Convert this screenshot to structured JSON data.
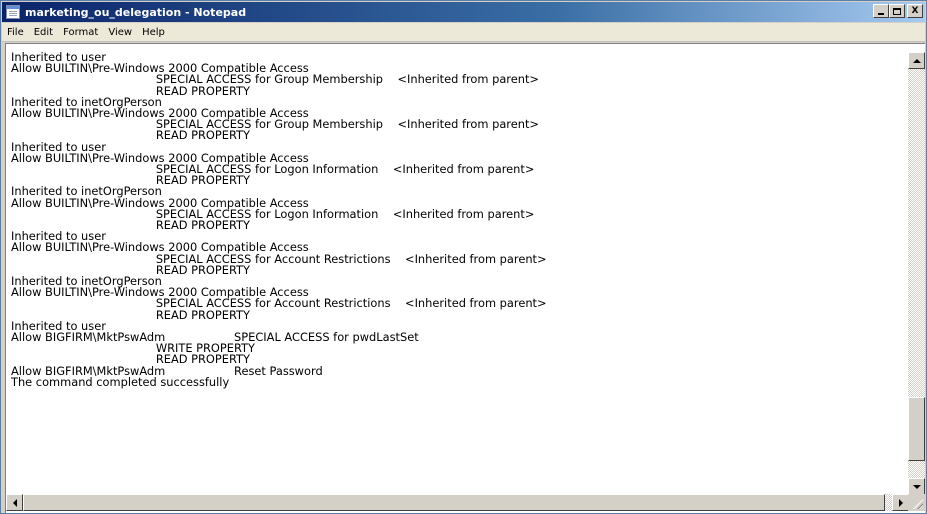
{
  "window": {
    "title": "marketing_ou_delegation - Notepad",
    "app_icon": "notepad-icon"
  },
  "title_buttons": {
    "minimize": "minimize-icon",
    "maximize": "maximize-icon",
    "close_label": "X"
  },
  "menu": [
    {
      "label": "File"
    },
    {
      "label": "Edit"
    },
    {
      "label": "Format"
    },
    {
      "label": "View"
    },
    {
      "label": "Help"
    }
  ],
  "document": {
    "text": "Inherited to user\nAllow BUILTIN\\Pre-Windows 2000 Compatible Access\n                                        SPECIAL ACCESS for Group Membership    <Inherited from parent>\n                                        READ PROPERTY\nInherited to inetOrgPerson\nAllow BUILTIN\\Pre-Windows 2000 Compatible Access\n                                        SPECIAL ACCESS for Group Membership    <Inherited from parent>\n                                        READ PROPERTY\nInherited to user\nAllow BUILTIN\\Pre-Windows 2000 Compatible Access\n                                        SPECIAL ACCESS for Logon Information    <Inherited from parent>\n                                        READ PROPERTY\nInherited to inetOrgPerson\nAllow BUILTIN\\Pre-Windows 2000 Compatible Access\n                                        SPECIAL ACCESS for Logon Information    <Inherited from parent>\n                                        READ PROPERTY\nInherited to user\nAllow BUILTIN\\Pre-Windows 2000 Compatible Access\n                                        SPECIAL ACCESS for Account Restrictions    <Inherited from parent>\n                                        READ PROPERTY\nInherited to inetOrgPerson\nAllow BUILTIN\\Pre-Windows 2000 Compatible Access\n                                        SPECIAL ACCESS for Account Restrictions    <Inherited from parent>\n                                        READ PROPERTY\nInherited to user\nAllow BIGFIRM\\MktPswAdm                   SPECIAL ACCESS for pwdLastSet\n                                        WRITE PROPERTY\n                                        READ PROPERTY\nAllow BIGFIRM\\MktPswAdm                   Reset Password\nThe command completed successfully"
  },
  "colors": {
    "titlebar_start": "#0a246a",
    "titlebar_end": "#a6caf0",
    "chrome": "#d4d0c8"
  }
}
